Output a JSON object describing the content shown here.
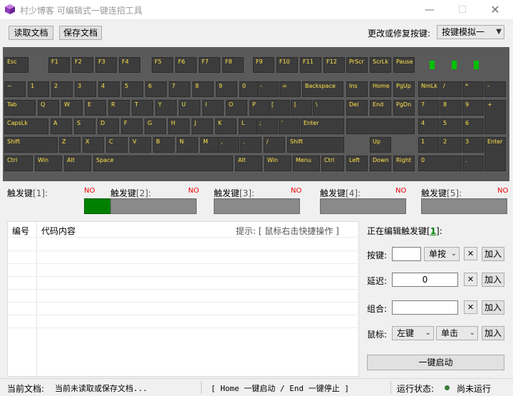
{
  "window": {
    "title": "村少博客 可编辑式一键连招工具",
    "minimize": "—",
    "maximize": "☐",
    "close": "✕"
  },
  "toolbar": {
    "open_label": "读取文档",
    "save_label": "保存文档",
    "mode_label": "更改或修复按键:",
    "mode_value": "按键模拟一"
  },
  "keyboard": {
    "keys": [
      "Esc",
      "F1",
      "F2",
      "F3",
      "F4",
      "F5",
      "F6",
      "F7",
      "F8",
      "F9",
      "F10",
      "F11",
      "F12",
      "PrScr",
      "ScrLk",
      "Pause",
      "~",
      "1",
      "2",
      "3",
      "4",
      "5",
      "6",
      "7",
      "8",
      "9",
      "0",
      "-",
      "=",
      "Backspace",
      "Ins",
      "Home",
      "PgUp",
      "NmLk",
      "/",
      "*",
      "-",
      "Tab",
      "Q",
      "W",
      "E",
      "R",
      "T",
      "Y",
      "U",
      "I",
      "O",
      "P",
      "[",
      "]",
      "\\",
      "Del",
      "End",
      "PgDn",
      "7",
      "8",
      "9",
      "+",
      "CapsLk",
      "A",
      "S",
      "D",
      "F",
      "G",
      "H",
      "J",
      "K",
      "L",
      ";",
      "'",
      "Enter",
      "4",
      "5",
      "6",
      "Shift",
      "Z",
      "X",
      "C",
      "V",
      "B",
      "N",
      "M",
      ",",
      ".",
      "/",
      "Shift",
      "Up",
      "1",
      "2",
      "3",
      "Enter",
      "Ctrl",
      "Win",
      "Alt",
      "Space",
      "Alt",
      "Win",
      "Menu",
      "Ctrl",
      "Left",
      "Down",
      "Right",
      "0",
      "."
    ]
  },
  "triggers": [
    {
      "label": "触发键",
      "index": "[1]:",
      "state": "NO"
    },
    {
      "label": "触发键",
      "index": "[2]:",
      "state": "NO"
    },
    {
      "label": "触发键",
      "index": "[3]:",
      "state": "NO"
    },
    {
      "label": "触发键",
      "index": "[4]:",
      "state": "NO"
    },
    {
      "label": "触发键",
      "index": "[5]:",
      "state": "NO"
    }
  ],
  "list": {
    "col_no": "编号",
    "col_code": "代码内容",
    "hint": "提示: [ 鼠标右击快捷操作 ]"
  },
  "editor": {
    "title_prefix": "正在编辑触发键[",
    "title_num": "1",
    "title_suffix": "]:",
    "key_label": "按键:",
    "key_value": "",
    "key_mode": "单按",
    "delay_label": "延迟:",
    "delay_value": "0",
    "combo_label": "组合:",
    "combo_value": "",
    "mouse_label": "鼠标:",
    "mouse_button": "左键",
    "mouse_action": "单击",
    "clear": "✕",
    "add": "加入",
    "start": "一键启动"
  },
  "status": {
    "doc_label": "当前文档:",
    "doc_value": "当前未读取或保存文档...",
    "hotkeys": "[  Home 一键启动 / End 一键停止  ]",
    "run_label": "运行状态:",
    "run_value": "尚未运行"
  },
  "colors": {
    "active_trigger": "#008000",
    "inactive_trigger": "#8a8a8a",
    "key_text": "#ffe34a",
    "led": "#00c000"
  }
}
